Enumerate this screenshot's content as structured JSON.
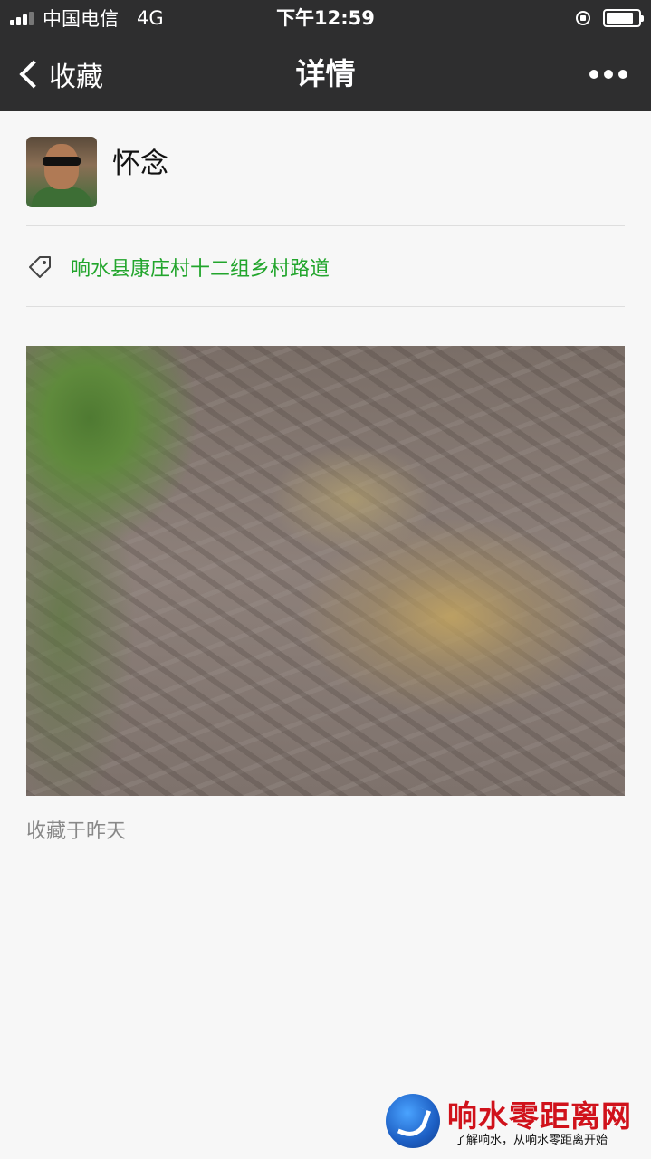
{
  "status_bar": {
    "carrier": "中国电信",
    "network": "4G",
    "time": "下午12:59"
  },
  "nav": {
    "back_label": "收藏",
    "title": "详情"
  },
  "author": {
    "name": "怀念"
  },
  "tag": {
    "text": "响水县康庄村十二组乡村路道",
    "color": "#22a52c"
  },
  "footer": {
    "collected_text": "收藏于昨天"
  },
  "watermark": {
    "title": "响水零距离网",
    "subtitle": "了解响水，从响水零距离开始"
  },
  "colors": {
    "header_bg": "#2e2e2f",
    "page_bg": "#f7f7f7"
  },
  "icons": [
    "back-chevron-icon",
    "more-icon",
    "tag-icon",
    "battery-icon",
    "signal-icon"
  ]
}
